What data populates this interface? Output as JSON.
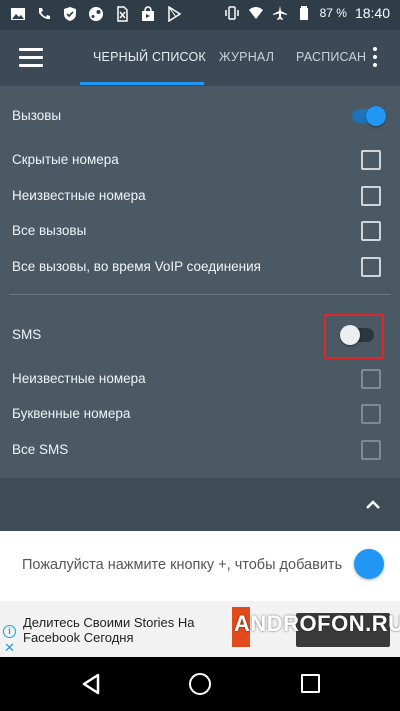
{
  "status_bar": {
    "left_icons": [
      "gallery-icon",
      "phone-icon",
      "shield-icon",
      "steam-icon",
      "sim-off-icon",
      "shopping-bag-icon",
      "play-store-icon"
    ],
    "battery_percent": "87 %",
    "time": "18:40"
  },
  "app_bar": {
    "tabs": [
      {
        "label": "ЧЕРНЫЙ СПИСОК",
        "active": true
      },
      {
        "label": "ЖУРНАЛ",
        "active": false
      },
      {
        "label": "РАСПИСАН",
        "active": false
      }
    ]
  },
  "calls": {
    "header": "Вызовы",
    "enabled": true,
    "items": [
      {
        "label": "Скрытые номера",
        "checked": false
      },
      {
        "label": "Неизвестные номера",
        "checked": false
      },
      {
        "label": "Все вызовы",
        "checked": false
      },
      {
        "label": "Все вызовы, во время VoIP соединения",
        "checked": false
      }
    ]
  },
  "sms": {
    "header": "SMS",
    "enabled": false,
    "items": [
      {
        "label": "Неизвестные номера",
        "checked": false
      },
      {
        "label": "Буквенные номера",
        "checked": false
      },
      {
        "label": "Все SMS",
        "checked": false
      }
    ]
  },
  "hint": {
    "text": "Пожалуйста нажмите кнопку +, чтобы добавить"
  },
  "ad": {
    "text": "Делитесь Своими Stories На Facebook Сегодня"
  },
  "watermark": "ANDROFON.RU",
  "colors": {
    "accent": "#2196f3",
    "panel": "#4a5963",
    "appbar": "#3b4a56",
    "highlight": "#e0262b"
  }
}
